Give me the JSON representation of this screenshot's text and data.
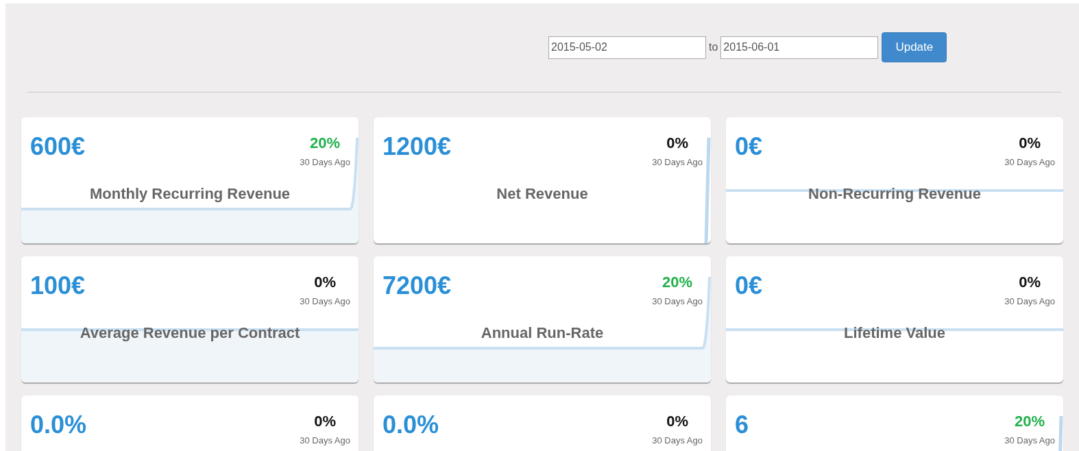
{
  "date_range": {
    "from": "2015-05-02",
    "separator": "to",
    "to": "2015-06-01",
    "button": "Update"
  },
  "cards": [
    {
      "kind": "rise",
      "value": "600€",
      "change": "20%",
      "color": "#22b14c",
      "period": "30 Days Ago",
      "title": "Monthly Recurring Revenue"
    },
    {
      "kind": "spike",
      "value": "1200€",
      "change": "0%",
      "color": "#111111",
      "period": "30 Days Ago",
      "title": "Net Revenue"
    },
    {
      "kind": "flat",
      "value": "0€",
      "change": "0%",
      "color": "#111111",
      "period": "30 Days Ago",
      "title": "Non-Recurring Revenue"
    },
    {
      "kind": "filled",
      "value": "100€",
      "change": "0%",
      "color": "#111111",
      "period": "30 Days Ago",
      "title": "Average Revenue per Contract"
    },
    {
      "kind": "rise",
      "value": "7200€",
      "change": "20%",
      "color": "#22b14c",
      "period": "30 Days Ago",
      "title": "Annual Run-Rate"
    },
    {
      "kind": "flat",
      "value": "0€",
      "change": "0%",
      "color": "#111111",
      "period": "30 Days Ago",
      "title": "Lifetime Value"
    },
    {
      "kind": "blank",
      "value": "0.0%",
      "change": "0%",
      "color": "#111111",
      "period": "30 Days Ago"
    },
    {
      "kind": "blank",
      "value": "0.0%",
      "change": "0%",
      "color": "#111111",
      "period": "30 Days Ago"
    },
    {
      "kind": "spike",
      "value": "6",
      "change": "20%",
      "color": "#22b14c",
      "period": "30 Days Ago"
    }
  ]
}
